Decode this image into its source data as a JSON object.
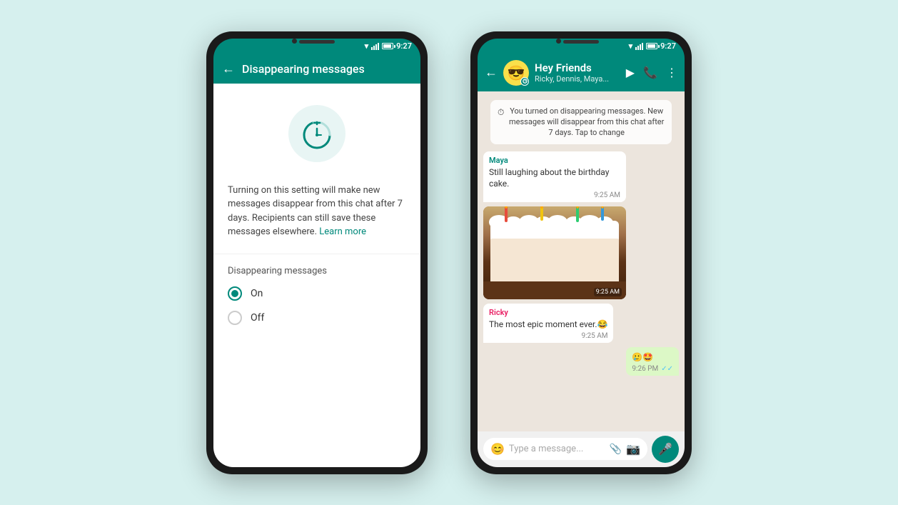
{
  "background_color": "#d6f0ee",
  "phone1": {
    "status_bar": {
      "time": "9:27"
    },
    "app_bar": {
      "title": "Disappearing messages",
      "back_label": "←"
    },
    "description": "Turning on this setting will make new messages disappear from this chat after 7 days. Recipients can still save these messages elsewhere.",
    "learn_more": "Learn more",
    "section_label": "Disappearing messages",
    "radio_options": [
      {
        "label": "On",
        "selected": true
      },
      {
        "label": "Off",
        "selected": false
      }
    ]
  },
  "phone2": {
    "status_bar": {
      "time": "9:27"
    },
    "app_bar": {
      "group_name": "Hey Friends",
      "members": "Ricky, Dennis, Maya...",
      "back_label": "←"
    },
    "system_note": "You turned on disappearing messages. New messages will disappear from this chat after 7 days. Tap to change",
    "messages": [
      {
        "type": "incoming",
        "sender": "Maya",
        "sender_color": "teal",
        "text": "Still laughing about the birthday cake.",
        "time": "9:25 AM"
      },
      {
        "type": "image",
        "time": "9:25 AM"
      },
      {
        "type": "incoming",
        "sender": "Ricky",
        "sender_color": "pink",
        "text": "The most epic moment ever.😂",
        "time": "9:25 AM"
      },
      {
        "type": "outgoing",
        "emoji": "🥲🤩",
        "time": "9:26 PM",
        "ticks": "✓✓"
      }
    ],
    "input": {
      "placeholder": "Type a message...",
      "emoji_icon": "😊",
      "mic_icon": "🎤"
    }
  }
}
